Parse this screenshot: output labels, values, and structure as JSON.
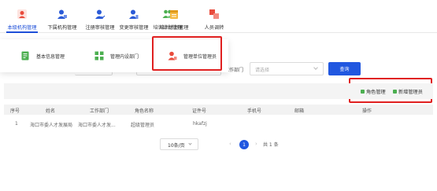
{
  "nav": {
    "items": [
      {
        "label": "本级机构管理",
        "color": "#e94b3c"
      },
      {
        "label": "下属机构管理",
        "color": "#2b5bd7"
      },
      {
        "label": "注册审核管理",
        "color": "#2b5bd7"
      },
      {
        "label": "变更审核管理",
        "color": "#2b5bd7"
      },
      {
        "label": "培训计划管理",
        "color": "#4caf50"
      },
      {
        "label": "培训计划管理",
        "color": "#f5b942"
      },
      {
        "label": "人员调转",
        "color": "#e94b3c"
      }
    ]
  },
  "dropdown": {
    "items": [
      {
        "label": "基本信息管理",
        "icon": "document-icon"
      },
      {
        "label": "管理内设部门",
        "icon": "grid-icon"
      },
      {
        "label": "管理单位管理员",
        "icon": "user-lock-icon"
      }
    ]
  },
  "search": {
    "dept_label": "工作部门",
    "dept_placeholder": "请选择",
    "query_button": "查询"
  },
  "toolbar": {
    "role_manage": "角色管理",
    "add_admin": "新增管理员"
  },
  "table": {
    "headers": [
      "序号",
      "姓名",
      "工作部门",
      "角色名称",
      "证件号",
      "手机号",
      "邮箱",
      "操作"
    ],
    "rows": [
      [
        "1",
        "海口市委人才发展局",
        "海口市委人才发...",
        "超级管理员",
        "hkafzj",
        "",
        "",
        ""
      ]
    ]
  },
  "pagination": {
    "page_size": "10条/页",
    "current_page": "1",
    "prev": "‹",
    "next": "›",
    "total": "共 1 条"
  },
  "colors": {
    "accent": "#2157e0",
    "highlight_box": "#e02020",
    "toolbar_icon": "#4caf50"
  }
}
